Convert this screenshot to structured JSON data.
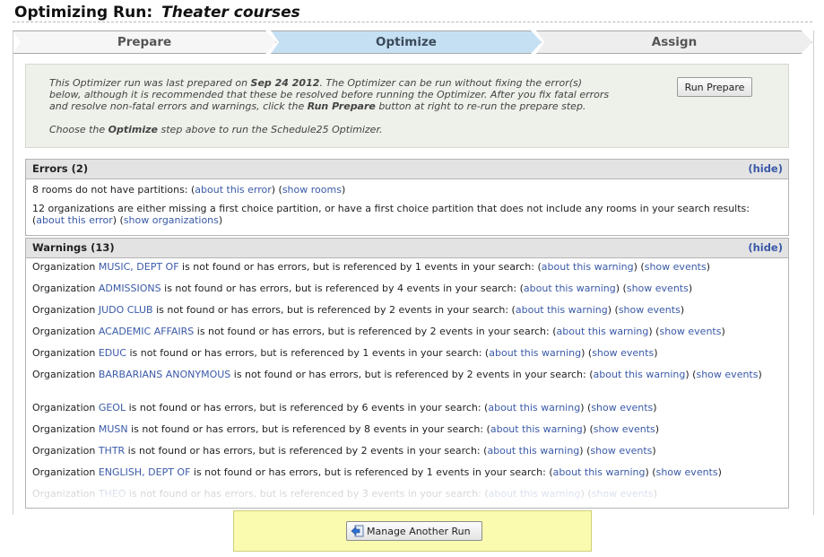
{
  "header": {
    "label": "Optimizing Run:",
    "run_name": "Theater courses"
  },
  "steps": [
    {
      "label": "Prepare",
      "state": "current"
    },
    {
      "label": "Optimize",
      "state": "next"
    },
    {
      "label": "Assign",
      "state": "pending"
    }
  ],
  "info": {
    "line1_a": "This Optimizer run was last prepared on ",
    "date": "Sep 24 2012",
    "line1_b": ". The Optimizer can be run without fixing the error(s)",
    "line2": "below, although it is recommended that these be resolved before running the Optimizer. After you fix fatal errors",
    "line3_a": "and resolve non-fatal errors and warnings, click the ",
    "run_prepare_ref": "Run Prepare",
    "line3_b": " button at right to re-run the prepare step.",
    "line4_a": "Choose the ",
    "optimize_ref": "Optimize",
    "line4_b": " step above to run the Schedule25 Optimizer.",
    "button": "Run Prepare"
  },
  "errors": {
    "title": "Errors (2)",
    "hide": "(hide)",
    "items": [
      {
        "text": "8 rooms do not have partitions: (",
        "link1": "about this error",
        "mid": ") (",
        "link2": "show rooms",
        "end": ")"
      },
      {
        "text": "12 organizations are either missing a first choice partition, or have a first choice partition that does not include any rooms in your search results: (",
        "link1": "about this error",
        "mid": ") (",
        "link2": "show organizations",
        "end": ")"
      }
    ]
  },
  "warnings": {
    "title": "Warnings (13)",
    "hide": "(hide)",
    "prefix": "Organization ",
    "about": "about this warning",
    "show": "show events",
    "items": [
      {
        "org": "MUSIC, DEPT OF",
        "text": " is not found or has errors, but is referenced by 1 events in your search: ("
      },
      {
        "org": "ADMISSIONS",
        "text": " is not found or has errors, but is referenced by 4 events in your search: ("
      },
      {
        "org": "JUDO CLUB",
        "text": " is not found or has errors, but is referenced by 2 events in your search: ("
      },
      {
        "org": "ACADEMIC AFFAIRS",
        "text": " is not found or has errors, but is referenced by 2 events in your search: ("
      },
      {
        "org": "EDUC",
        "text": " is not found or has errors, but is referenced by 1 events in your search: ("
      },
      {
        "org": "BARBARIANS ANONYMOUS",
        "text": " is not found or has errors, but is referenced by 2 events in your search: ("
      },
      {
        "org": "GEOL",
        "text": " is not found or has errors, but is referenced by 6 events in your search: ("
      },
      {
        "org": "MUSN",
        "text": " is not found or has errors, but is referenced by 8 events in your search: ("
      },
      {
        "org": "THTR",
        "text": " is not found or has errors, but is referenced by 2 events in your search: ("
      },
      {
        "org": "ENGLISH, DEPT OF",
        "text": " is not found or has errors, but is referenced by 1 events in your search: ("
      },
      {
        "org": "THEO",
        "text": " is not found or has errors, but is referenced by 3 events in your search: ("
      }
    ]
  },
  "footer": {
    "button": "Manage Another Run",
    "button_icon": "back-arrow-icon"
  },
  "colors": {
    "link": "#3a5aa8",
    "step_active": "#c6e0f3",
    "footer_bg": "#fbfbb0"
  }
}
